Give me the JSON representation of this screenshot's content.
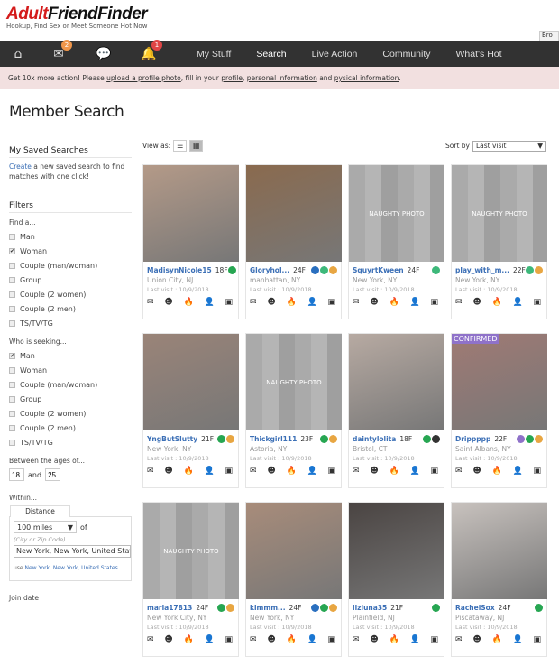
{
  "logo": {
    "part1": "Adult",
    "part2": "FriendFinder",
    "tagline": "Hookup, Find Sex or Meet Someone Hot Now"
  },
  "browser_button": "Bro",
  "nav": {
    "icons": [
      {
        "name": "home-icon",
        "glyph": "⌂"
      },
      {
        "name": "mail-icon",
        "glyph": "✉",
        "badge": "2",
        "badge_color": "#f0964a"
      },
      {
        "name": "chat-icon",
        "glyph": "💬"
      },
      {
        "name": "bell-icon",
        "glyph": "🔔",
        "badge": "1",
        "badge_color": "#e04545"
      }
    ],
    "links": [
      "My Stuff",
      "Search",
      "Live Action",
      "Community",
      "What's Hot"
    ],
    "active": "Search"
  },
  "banner": {
    "prefix": "Get 10x more action! Please ",
    "link1": "upload a profile photo",
    "mid1": ", fill in your ",
    "link2": "profile",
    "mid2": ", ",
    "link3": "personal information",
    "mid3": " and ",
    "link4": "pysical information",
    "suffix": "."
  },
  "page_title": "Member Search",
  "sidebar": {
    "saved_title": "My Saved Searches",
    "create_link": "Create",
    "create_text": " a new saved search to find matches with one click!",
    "filters_title": "Filters",
    "find_label": "Find a...",
    "find_options": [
      {
        "label": "Man",
        "checked": false
      },
      {
        "label": "Woman",
        "checked": true
      },
      {
        "label": "Couple (man/woman)",
        "checked": false
      },
      {
        "label": "Group",
        "checked": false
      },
      {
        "label": "Couple (2 women)",
        "checked": false
      },
      {
        "label": "Couple (2 men)",
        "checked": false
      },
      {
        "label": "TS/TV/TG",
        "checked": false
      }
    ],
    "seeking_label": "Who is seeking...",
    "seeking_options": [
      {
        "label": "Man",
        "checked": true
      },
      {
        "label": "Woman",
        "checked": false
      },
      {
        "label": "Couple (man/woman)",
        "checked": false
      },
      {
        "label": "Group",
        "checked": false
      },
      {
        "label": "Couple (2 women)",
        "checked": false
      },
      {
        "label": "Couple (2 men)",
        "checked": false
      },
      {
        "label": "TS/TV/TG",
        "checked": false
      }
    ],
    "ages_label": "Between the ages of...",
    "age_min": "18",
    "age_and": "and",
    "age_max": "25",
    "within_label": "Within...",
    "distance_tab": "Distance",
    "distance_value": "100 miles",
    "of_label": "of",
    "city_hint": "(City or Zip Code)",
    "city_value": "New York, New York, United States",
    "use_prefix": "use ",
    "use_link": "New York, New York, United States",
    "join_label": "Join date"
  },
  "toolbar": {
    "view_as": "View as:",
    "sort_by": "Sort by",
    "sort_value": "Last visit"
  },
  "action_icons": [
    "✉",
    "☻",
    "🔥",
    "👤",
    "▣"
  ],
  "badge_colors": {
    "verified": "#2a6fbf",
    "online": "#27a652",
    "chat": "#3db87a",
    "gold": "#e8a642",
    "purple": "#8f72c9",
    "dark": "#333333"
  },
  "members": [
    {
      "username": "MadisynNicole15",
      "age": "18F",
      "location": "Union City, NJ",
      "last_visit": "Last visit : 10/9/2018",
      "badges": [
        "online"
      ],
      "photo": "photo",
      "tone": "#b49a88"
    },
    {
      "username": "Gloryhol...",
      "age": "24F",
      "location": "manhattan, NY",
      "last_visit": "Last visit : 10/9/2018",
      "badges": [
        "verified",
        "chat",
        "gold"
      ],
      "photo": "photo",
      "tone": "#8a6a4e"
    },
    {
      "username": "SquyrtKween",
      "age": "24F",
      "location": "New York, NY",
      "last_visit": "Last visit : 10/9/2018",
      "badges": [
        "chat"
      ],
      "photo": "naughty",
      "naughty_text": "NAUGHTY PHOTO"
    },
    {
      "username": "play_with_m...",
      "age": "22F",
      "location": "New York, NY",
      "last_visit": "Last visit : 10/9/2018",
      "badges": [
        "chat",
        "gold"
      ],
      "photo": "naughty",
      "naughty_text": "NAUGHTY PHOTO"
    },
    {
      "username": "YngButSlutty",
      "age": "21F",
      "location": "New York, NY",
      "last_visit": "Last visit : 10/9/2018",
      "badges": [
        "online",
        "gold"
      ],
      "photo": "photo",
      "tone": "#9a8478"
    },
    {
      "username": "Thickgirl111",
      "age": "23F",
      "location": "Astoria, NY",
      "last_visit": "Last visit : 10/9/2018",
      "badges": [
        "online",
        "gold"
      ],
      "photo": "naughty",
      "naughty_text": "NAUGHTY PHOTO"
    },
    {
      "username": "daintylolita",
      "age": "18F",
      "location": "Bristol, CT",
      "last_visit": "Last visit : 10/9/2018",
      "badges": [
        "online",
        "dark"
      ],
      "photo": "photo",
      "tone": "#b7aaa2"
    },
    {
      "username": "Drippppp",
      "age": "22F",
      "location": "Saint Albans, NY",
      "last_visit": "Last visit : 10/9/2018",
      "badges": [
        "purple",
        "online",
        "gold"
      ],
      "photo": "photo",
      "tone": "#a07a74",
      "confirmed": "CONFIRMED"
    },
    {
      "username": "maria17813",
      "age": "24F",
      "location": "New York City, NY",
      "last_visit": "Last visit : 10/9/2018",
      "badges": [
        "online",
        "gold"
      ],
      "photo": "naughty",
      "naughty_text": "NAUGHTY PHOTO"
    },
    {
      "username": "kimmm...",
      "age": "24F",
      "location": "New York, NY",
      "last_visit": "Last visit : 10/9/2018",
      "badges": [
        "verified",
        "online",
        "gold"
      ],
      "photo": "photo",
      "tone": "#a88c7a"
    },
    {
      "username": "lizluna35",
      "age": "21F",
      "location": "Plainfield, NJ",
      "last_visit": "Last visit : 10/9/2018",
      "badges": [
        "online"
      ],
      "photo": "photo",
      "tone": "#4a4442"
    },
    {
      "username": "RachelSox",
      "age": "24F",
      "location": "Piscataway, NJ",
      "last_visit": "Last visit : 10/9/2018",
      "badges": [
        "online"
      ],
      "photo": "photo",
      "tone": "#c8c2be"
    }
  ]
}
